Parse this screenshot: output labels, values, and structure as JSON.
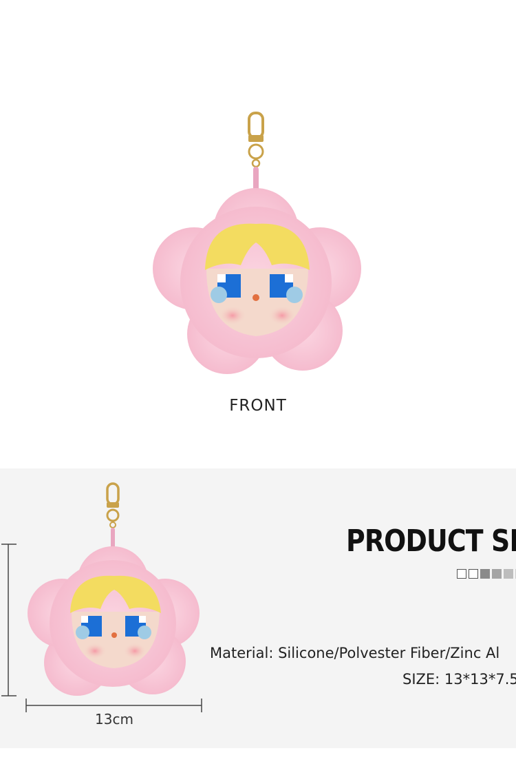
{
  "front_label": "FRONT",
  "product_size": {
    "title": "PRODUCT SIZ",
    "swatches": [
      "#ffffff",
      "#ffffff",
      "#8a8a8a",
      "#a5a5a5",
      "#bdbdbd",
      "#cfcfcf"
    ],
    "material": "Material: Silicone/Polvester Fiber/Zinc Al",
    "size": "SIZE: 13*13*7.5",
    "width_label": "13cm"
  },
  "colors": {
    "petal": "#f5bfd0",
    "hair": "#f3dc60",
    "eye": "#1c6fd6",
    "tear": "#9fcbe5",
    "face": "#f4d9cc",
    "gold": "#c9a24a",
    "band": "#e9a6c0",
    "section_bg": "#f4f4f4"
  }
}
